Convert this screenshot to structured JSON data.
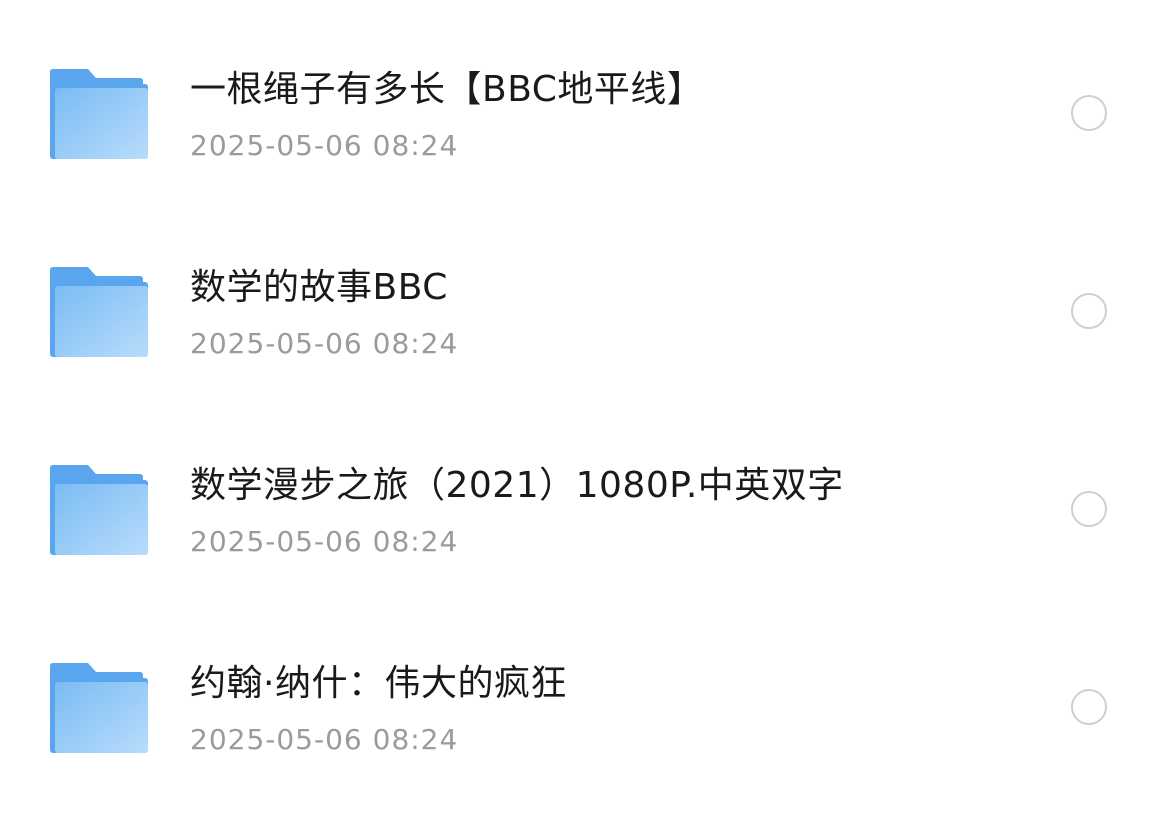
{
  "files": [
    {
      "name": "一根绳子有多长【BBC地平线】",
      "date": "2025-05-06 08:24"
    },
    {
      "name": "数学的故事BBC",
      "date": "2025-05-06 08:24"
    },
    {
      "name": "数学漫步之旅（2021）1080P.中英双字",
      "date": "2025-05-06 08:24"
    },
    {
      "name": "约翰·纳什：伟大的疯狂",
      "date": "2025-05-06 08:24"
    }
  ],
  "icons": {
    "item": "folder-icon",
    "select": "radio-unchecked-icon"
  },
  "colors": {
    "folder_light": "#b3d9fb",
    "folder_dark": "#5aa6ee",
    "title": "#1a1a1a",
    "date": "#9b9b9b",
    "radio_border": "#cfcfcf"
  }
}
